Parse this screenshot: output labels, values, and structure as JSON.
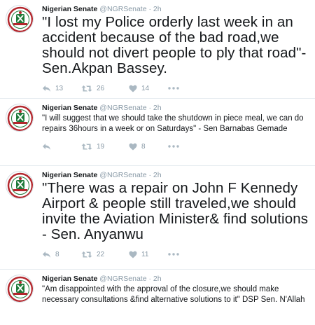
{
  "tweets": [
    {
      "name": "Nigerian Senate",
      "handle": "@NGRSenate",
      "separator": "·",
      "time": "2h",
      "text": "\"I lost my Police orderly last week in an accident because of the bad road,we should not divert people to ply that road\"- Sen.Akpan Bassey.",
      "size": "large",
      "replies": "13",
      "retweets": "26",
      "likes": "14"
    },
    {
      "name": "Nigerian Senate",
      "handle": "@NGRSenate",
      "separator": "·",
      "time": "2h",
      "text": "\"I will suggest that we should take the shutdown in piece meal, we can do  repairs 36hours in a week or on Saturdays\" - Sen Barnabas Gemade",
      "size": "small",
      "replies": "",
      "retweets": "19",
      "likes": "8"
    },
    {
      "name": "Nigerian Senate",
      "handle": "@NGRSenate",
      "separator": "·",
      "time": "2h",
      "text": "\"There was a repair on John F Kennedy Airport & people  still traveled,we should invite the Aviation Minister& find solutions - Sen. Anyanwu",
      "size": "large",
      "replies": "8",
      "retweets": "22",
      "likes": "11"
    },
    {
      "name": "Nigerian Senate",
      "handle": "@NGRSenate",
      "separator": "·",
      "time": "2h",
      "text": "\"Am disappointed with the approval of the closure,we should make necessary consultations &find alternative solutions to it\" DSP Sen. N'Allah",
      "size": "small",
      "replies": "",
      "retweets": "",
      "likes": ""
    }
  ],
  "colors": {
    "icon_gray": "#aab8c2",
    "meta_gray": "#8899a6",
    "seal_green": "#1f7a3a",
    "seal_red": "#b3272d"
  },
  "icons": [
    "reply-icon",
    "retweet-icon",
    "like-icon",
    "more-icon",
    "senate-seal-avatar"
  ]
}
